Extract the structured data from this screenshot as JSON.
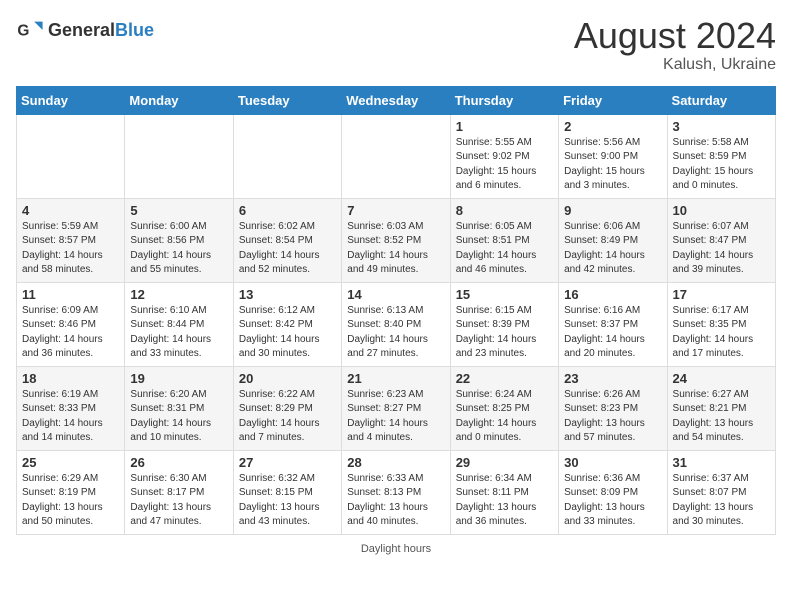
{
  "header": {
    "logo_general": "General",
    "logo_blue": "Blue",
    "month_year": "August 2024",
    "location": "Kalush, Ukraine"
  },
  "days_of_week": [
    "Sunday",
    "Monday",
    "Tuesday",
    "Wednesday",
    "Thursday",
    "Friday",
    "Saturday"
  ],
  "weeks": [
    [
      {
        "day": "",
        "info": ""
      },
      {
        "day": "",
        "info": ""
      },
      {
        "day": "",
        "info": ""
      },
      {
        "day": "",
        "info": ""
      },
      {
        "day": "1",
        "info": "Sunrise: 5:55 AM\nSunset: 9:02 PM\nDaylight: 15 hours\nand 6 minutes."
      },
      {
        "day": "2",
        "info": "Sunrise: 5:56 AM\nSunset: 9:00 PM\nDaylight: 15 hours\nand 3 minutes."
      },
      {
        "day": "3",
        "info": "Sunrise: 5:58 AM\nSunset: 8:59 PM\nDaylight: 15 hours\nand 0 minutes."
      }
    ],
    [
      {
        "day": "4",
        "info": "Sunrise: 5:59 AM\nSunset: 8:57 PM\nDaylight: 14 hours\nand 58 minutes."
      },
      {
        "day": "5",
        "info": "Sunrise: 6:00 AM\nSunset: 8:56 PM\nDaylight: 14 hours\nand 55 minutes."
      },
      {
        "day": "6",
        "info": "Sunrise: 6:02 AM\nSunset: 8:54 PM\nDaylight: 14 hours\nand 52 minutes."
      },
      {
        "day": "7",
        "info": "Sunrise: 6:03 AM\nSunset: 8:52 PM\nDaylight: 14 hours\nand 49 minutes."
      },
      {
        "day": "8",
        "info": "Sunrise: 6:05 AM\nSunset: 8:51 PM\nDaylight: 14 hours\nand 46 minutes."
      },
      {
        "day": "9",
        "info": "Sunrise: 6:06 AM\nSunset: 8:49 PM\nDaylight: 14 hours\nand 42 minutes."
      },
      {
        "day": "10",
        "info": "Sunrise: 6:07 AM\nSunset: 8:47 PM\nDaylight: 14 hours\nand 39 minutes."
      }
    ],
    [
      {
        "day": "11",
        "info": "Sunrise: 6:09 AM\nSunset: 8:46 PM\nDaylight: 14 hours\nand 36 minutes."
      },
      {
        "day": "12",
        "info": "Sunrise: 6:10 AM\nSunset: 8:44 PM\nDaylight: 14 hours\nand 33 minutes."
      },
      {
        "day": "13",
        "info": "Sunrise: 6:12 AM\nSunset: 8:42 PM\nDaylight: 14 hours\nand 30 minutes."
      },
      {
        "day": "14",
        "info": "Sunrise: 6:13 AM\nSunset: 8:40 PM\nDaylight: 14 hours\nand 27 minutes."
      },
      {
        "day": "15",
        "info": "Sunrise: 6:15 AM\nSunset: 8:39 PM\nDaylight: 14 hours\nand 23 minutes."
      },
      {
        "day": "16",
        "info": "Sunrise: 6:16 AM\nSunset: 8:37 PM\nDaylight: 14 hours\nand 20 minutes."
      },
      {
        "day": "17",
        "info": "Sunrise: 6:17 AM\nSunset: 8:35 PM\nDaylight: 14 hours\nand 17 minutes."
      }
    ],
    [
      {
        "day": "18",
        "info": "Sunrise: 6:19 AM\nSunset: 8:33 PM\nDaylight: 14 hours\nand 14 minutes."
      },
      {
        "day": "19",
        "info": "Sunrise: 6:20 AM\nSunset: 8:31 PM\nDaylight: 14 hours\nand 10 minutes."
      },
      {
        "day": "20",
        "info": "Sunrise: 6:22 AM\nSunset: 8:29 PM\nDaylight: 14 hours\nand 7 minutes."
      },
      {
        "day": "21",
        "info": "Sunrise: 6:23 AM\nSunset: 8:27 PM\nDaylight: 14 hours\nand 4 minutes."
      },
      {
        "day": "22",
        "info": "Sunrise: 6:24 AM\nSunset: 8:25 PM\nDaylight: 14 hours\nand 0 minutes."
      },
      {
        "day": "23",
        "info": "Sunrise: 6:26 AM\nSunset: 8:23 PM\nDaylight: 13 hours\nand 57 minutes."
      },
      {
        "day": "24",
        "info": "Sunrise: 6:27 AM\nSunset: 8:21 PM\nDaylight: 13 hours\nand 54 minutes."
      }
    ],
    [
      {
        "day": "25",
        "info": "Sunrise: 6:29 AM\nSunset: 8:19 PM\nDaylight: 13 hours\nand 50 minutes."
      },
      {
        "day": "26",
        "info": "Sunrise: 6:30 AM\nSunset: 8:17 PM\nDaylight: 13 hours\nand 47 minutes."
      },
      {
        "day": "27",
        "info": "Sunrise: 6:32 AM\nSunset: 8:15 PM\nDaylight: 13 hours\nand 43 minutes."
      },
      {
        "day": "28",
        "info": "Sunrise: 6:33 AM\nSunset: 8:13 PM\nDaylight: 13 hours\nand 40 minutes."
      },
      {
        "day": "29",
        "info": "Sunrise: 6:34 AM\nSunset: 8:11 PM\nDaylight: 13 hours\nand 36 minutes."
      },
      {
        "day": "30",
        "info": "Sunrise: 6:36 AM\nSunset: 8:09 PM\nDaylight: 13 hours\nand 33 minutes."
      },
      {
        "day": "31",
        "info": "Sunrise: 6:37 AM\nSunset: 8:07 PM\nDaylight: 13 hours\nand 30 minutes."
      }
    ]
  ],
  "footer": {
    "note": "Daylight hours"
  }
}
